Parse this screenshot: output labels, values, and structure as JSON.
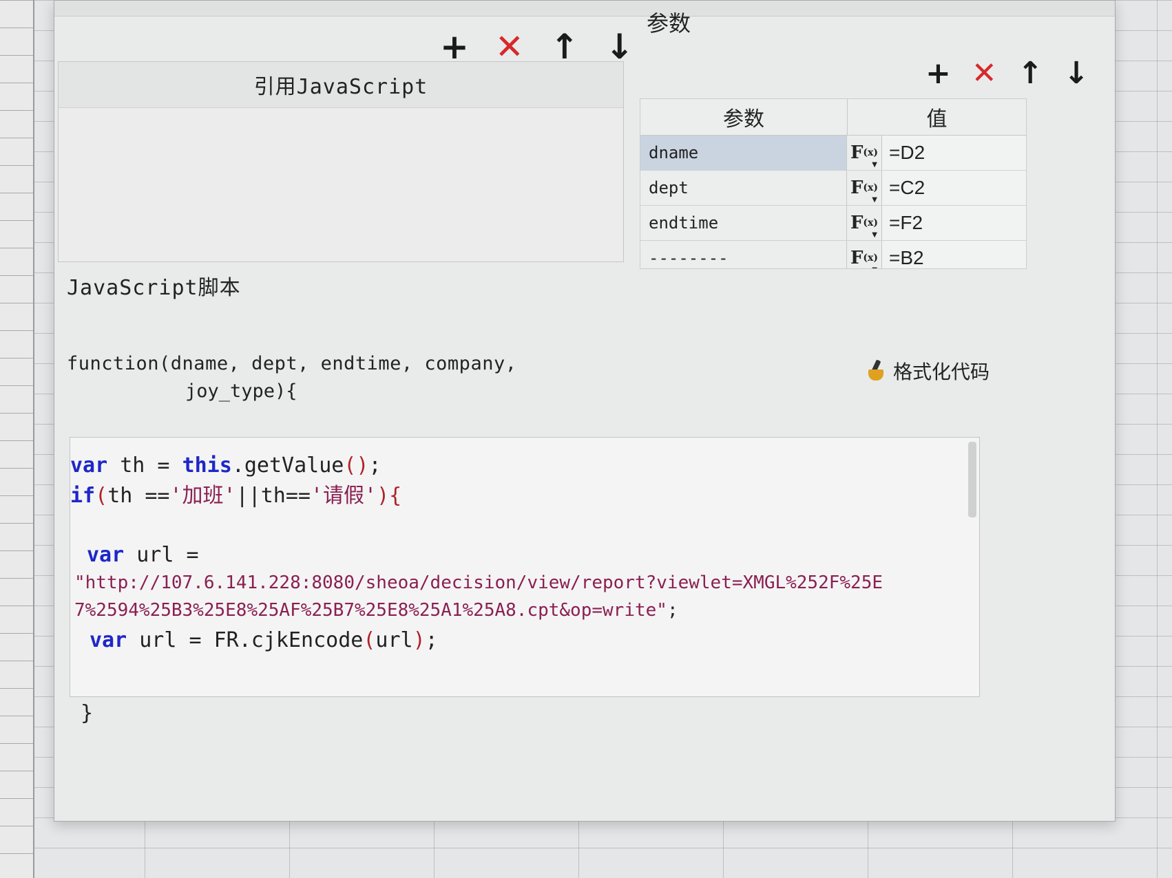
{
  "dialog": {
    "params_label": "参数",
    "ref_table": {
      "header": "引用JavaScript"
    },
    "toolbar_left": {
      "add": "+",
      "delete": "✕",
      "up": "↑",
      "down": "↓"
    },
    "toolbar_right": {
      "add": "+",
      "delete": "✕",
      "up": "↑",
      "down": "↓"
    },
    "param_table": {
      "col_param": "参数",
      "col_value": "值",
      "fx_label": "F",
      "fx_sub": "(x)",
      "rows": [
        {
          "name": "dname",
          "value": "=D2"
        },
        {
          "name": "dept",
          "value": "=C2"
        },
        {
          "name": "endtime",
          "value": "=F2"
        },
        {
          "name": "--------",
          "value": "=B2"
        }
      ]
    },
    "js_label": "JavaScript脚本",
    "function_signature_1": "function(dname, dept, endtime, company,",
    "function_signature_2": "joy_type){",
    "format_button": "格式化代码",
    "code": {
      "l1_kw": "var",
      "l1_a": " th = ",
      "l1_this": "this",
      "l1_b": ".getValue",
      "l1_paren": "()",
      "l1_c": ";",
      "l2_kw": "if",
      "l2_p1": "(",
      "l2_a": "th ==",
      "l2_s1": "'加班'",
      "l2_b": "||th==",
      "l2_s2": "'请假'",
      "l2_p2": "){",
      "l3_kw": "var",
      "l3_a": " url =",
      "l4_str": "\"http://107.6.141.228:8080/sheoa/decision/view/report?viewlet=XMGL%252F%25E",
      "l5_str": "7%2594%25B3%25E8%25AF%25B7%25E8%25A1%25A8.cpt&op=write\"",
      "l5_end": ";",
      "l6_kw": "var",
      "l6_a": " url = FR.cjkEncode",
      "l6_p1": "(",
      "l6_b": "url",
      "l6_p2": ")",
      "l6_c": ";"
    },
    "closing_brace": "}"
  }
}
